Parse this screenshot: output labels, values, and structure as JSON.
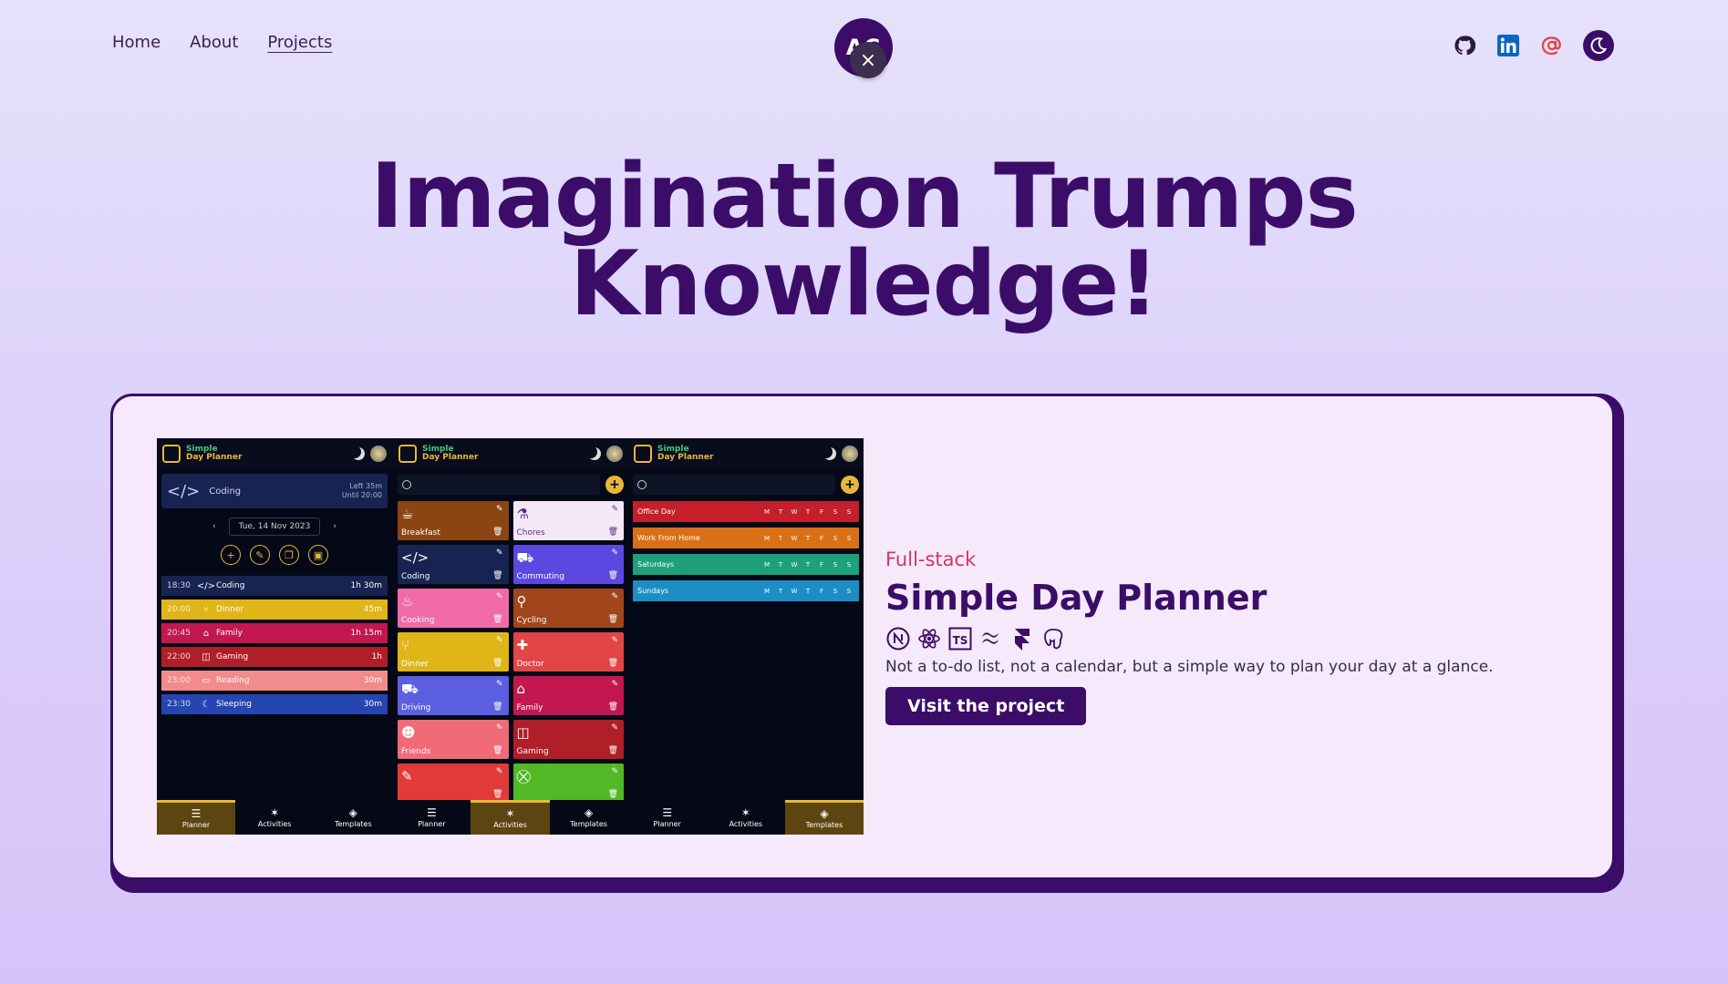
{
  "nav": {
    "items": [
      "Home",
      "About",
      "Projects"
    ],
    "active": "Projects"
  },
  "avatar": {
    "initials": "AC",
    "close": "×"
  },
  "social": [
    "github-icon",
    "linkedin-icon",
    "email-icon",
    "theme-toggle-icon"
  ],
  "hero": {
    "line1": "Imagination Trumps",
    "line2": "Knowledge!"
  },
  "project": {
    "category": "Full-stack",
    "title": "Simple Day Planner",
    "tech": [
      "nextjs-icon",
      "react-icon",
      "typescript-icon",
      "tailwind-icon",
      "framer-icon",
      "postgresql-icon"
    ],
    "description": "Not a to-do list, not a calendar, but a simple way to plan your day at a glance.",
    "cta": "Visit the project"
  },
  "screenshot": {
    "app_name_1": "Simple",
    "app_name_2": "Day Planner",
    "current": {
      "label": "Coding",
      "left": "Left 35m",
      "until": "Until 20:00"
    },
    "date": "Tue, 14 Nov 2023",
    "schedule": [
      {
        "time": "18:30",
        "name": "Coding",
        "dur": "1h 30m",
        "color": "#172350"
      },
      {
        "time": "20:00",
        "name": "Dinner",
        "dur": "45m",
        "color": "#e0b518"
      },
      {
        "time": "20:45",
        "name": "Family",
        "dur": "1h 15m",
        "color": "#c2184f"
      },
      {
        "time": "22:00",
        "name": "Gaming",
        "dur": "1h",
        "color": "#b01f28"
      },
      {
        "time": "23:00",
        "name": "Reading",
        "dur": "30m",
        "color": "#f28b8b"
      },
      {
        "time": "23:30",
        "name": "Sleeping",
        "dur": "30m",
        "color": "#2545b0"
      }
    ],
    "activities": [
      {
        "name": "Breakfast",
        "color": "#8b4513"
      },
      {
        "name": "Chores",
        "color": "#f4e8f6"
      },
      {
        "name": "Coding",
        "color": "#172350"
      },
      {
        "name": "Commuting",
        "color": "#5b48e0"
      },
      {
        "name": "Cooking",
        "color": "#f06aa8"
      },
      {
        "name": "Cycling",
        "color": "#a1461c"
      },
      {
        "name": "Dinner",
        "color": "#e0b518"
      },
      {
        "name": "Doctor",
        "color": "#e14545"
      },
      {
        "name": "Driving",
        "color": "#5b5fe0"
      },
      {
        "name": "Family",
        "color": "#c2184f"
      },
      {
        "name": "Friends",
        "color": "#f06a78"
      },
      {
        "name": "Gaming",
        "color": "#b01f28"
      },
      {
        "name": "",
        "color": "#e13a3a"
      },
      {
        "name": "",
        "color": "#52b825"
      }
    ],
    "templates": [
      {
        "name": "Office Day",
        "color": "#c41f2a"
      },
      {
        "name": "Work From Home",
        "color": "#d97016"
      },
      {
        "name": "Saturdays",
        "color": "#1ea07a"
      },
      {
        "name": "Sundays",
        "color": "#1c8ec4"
      }
    ],
    "days": [
      "M",
      "T",
      "W",
      "T",
      "F",
      "S",
      "S"
    ],
    "tabs": [
      "Planner",
      "Activities",
      "Templates",
      "Planner",
      "Activities",
      "Templates",
      "Planner",
      "Activities",
      "Templates"
    ]
  }
}
